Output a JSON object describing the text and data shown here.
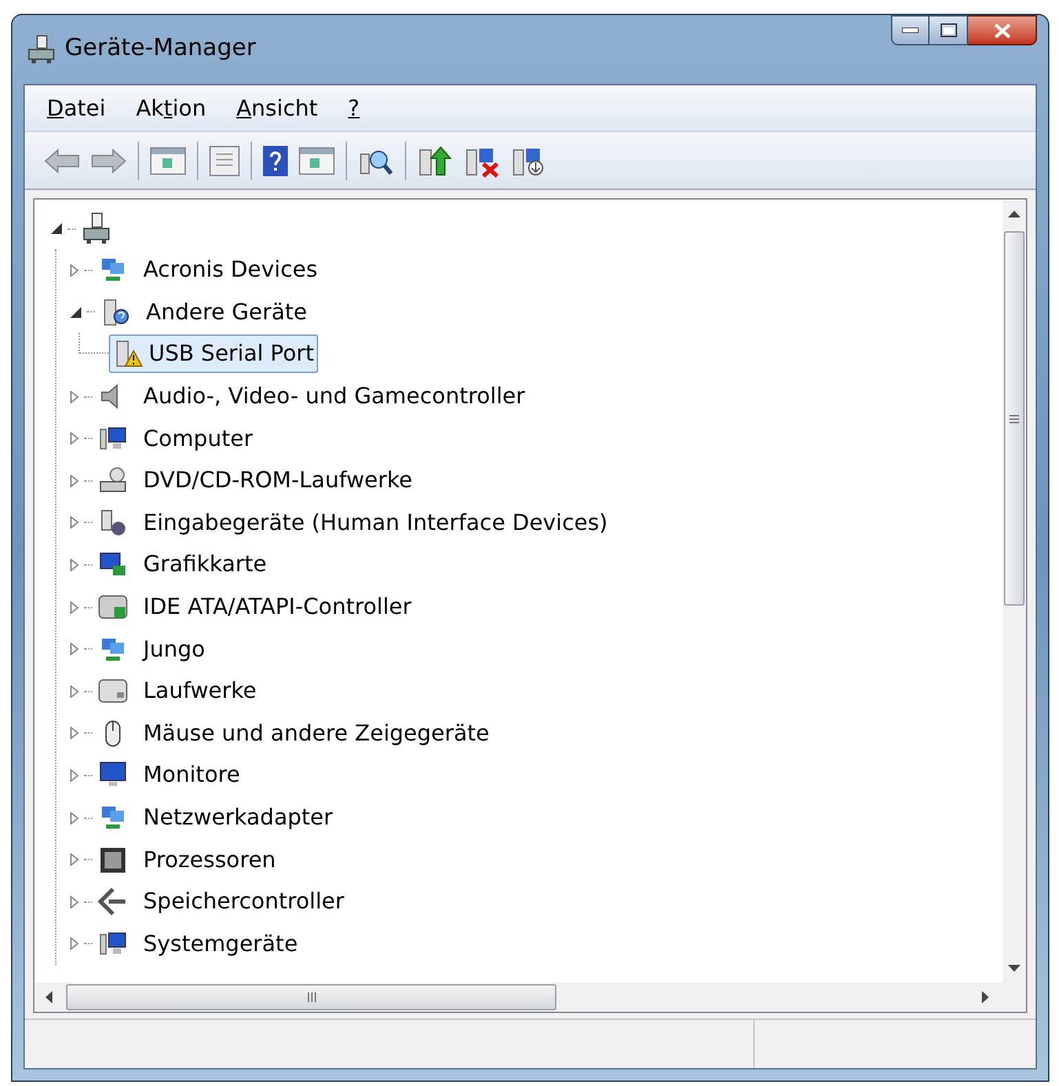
{
  "window": {
    "title": "Geräte-Manager"
  },
  "menu": [
    {
      "accel": "D",
      "after": "atei"
    },
    {
      "before": "Ak",
      "accel": "t",
      "after": "ion"
    },
    {
      "accel": "A",
      "after": "nsicht"
    },
    {
      "accel": "?"
    }
  ],
  "tree": {
    "expanded": true,
    "children": [
      {
        "label": "Acronis Devices",
        "expanded": false,
        "selected": false
      },
      {
        "label": "Andere Geräte",
        "expanded": true,
        "selected": false,
        "children": [
          {
            "label": "USB Serial Port",
            "selected": true
          }
        ]
      },
      {
        "label": "Audio-, Video- und Gamecontroller",
        "expanded": false,
        "selected": false
      },
      {
        "label": "Computer",
        "expanded": false,
        "selected": false
      },
      {
        "label": "DVD/CD-ROM-Laufwerke",
        "expanded": false,
        "selected": false
      },
      {
        "label": "Eingabegeräte (Human Interface Devices)",
        "expanded": false,
        "selected": false
      },
      {
        "label": "Grafikkarte",
        "expanded": false,
        "selected": false
      },
      {
        "label": "IDE ATA/ATAPI-Controller",
        "expanded": false,
        "selected": false
      },
      {
        "label": "Jungo",
        "expanded": false,
        "selected": false
      },
      {
        "label": "Laufwerke",
        "expanded": false,
        "selected": false
      },
      {
        "label": "Mäuse und andere Zeigegeräte",
        "expanded": false,
        "selected": false
      },
      {
        "label": "Monitore",
        "expanded": false,
        "selected": false
      },
      {
        "label": "Netzwerkadapter",
        "expanded": false,
        "selected": false
      },
      {
        "label": "Prozessoren",
        "expanded": false,
        "selected": false
      },
      {
        "label": "Speichercontroller",
        "expanded": false,
        "selected": false
      },
      {
        "label": "Systemgeräte",
        "expanded": false,
        "selected": false
      }
    ]
  }
}
